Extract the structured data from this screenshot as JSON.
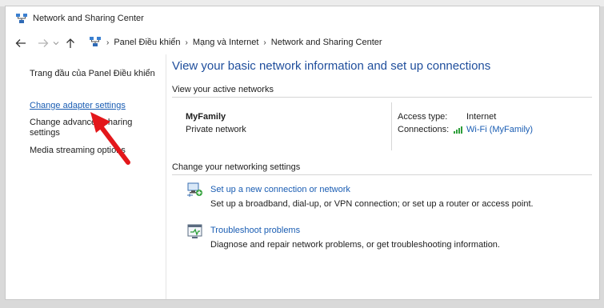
{
  "window": {
    "title": "Network and Sharing Center"
  },
  "breadcrumb": [
    "Panel Điều khiển",
    "Mạng và Internet",
    "Network and Sharing Center"
  ],
  "sidebar": {
    "items": [
      {
        "label": "Trang đầu của Panel Điều khiển",
        "link": false
      },
      {
        "label": "Change adapter settings",
        "link": true
      },
      {
        "label": "Change advanced sharing settings",
        "link": false
      },
      {
        "label": "Media streaming options",
        "link": false
      }
    ]
  },
  "main": {
    "heading": "View your basic network information and set up connections",
    "active_networks_label": "View your active networks",
    "network": {
      "name": "MyFamily",
      "type": "Private network",
      "access_type_label": "Access type:",
      "access_type_value": "Internet",
      "connections_label": "Connections:",
      "connections_value": "Wi-Fi (MyFamily)"
    },
    "change_settings_label": "Change your networking settings",
    "tasks": [
      {
        "title": "Set up a new connection or network",
        "desc": "Set up a broadband, dial-up, or VPN connection; or set up a router or access point.",
        "icon": "network-setup-icon"
      },
      {
        "title": "Troubleshoot problems",
        "desc": "Diagnose and repair network problems, or get troubleshooting information.",
        "icon": "troubleshoot-icon"
      }
    ]
  },
  "annotation": {
    "color": "#e3171b",
    "icon": "red-arrow-pointer"
  }
}
